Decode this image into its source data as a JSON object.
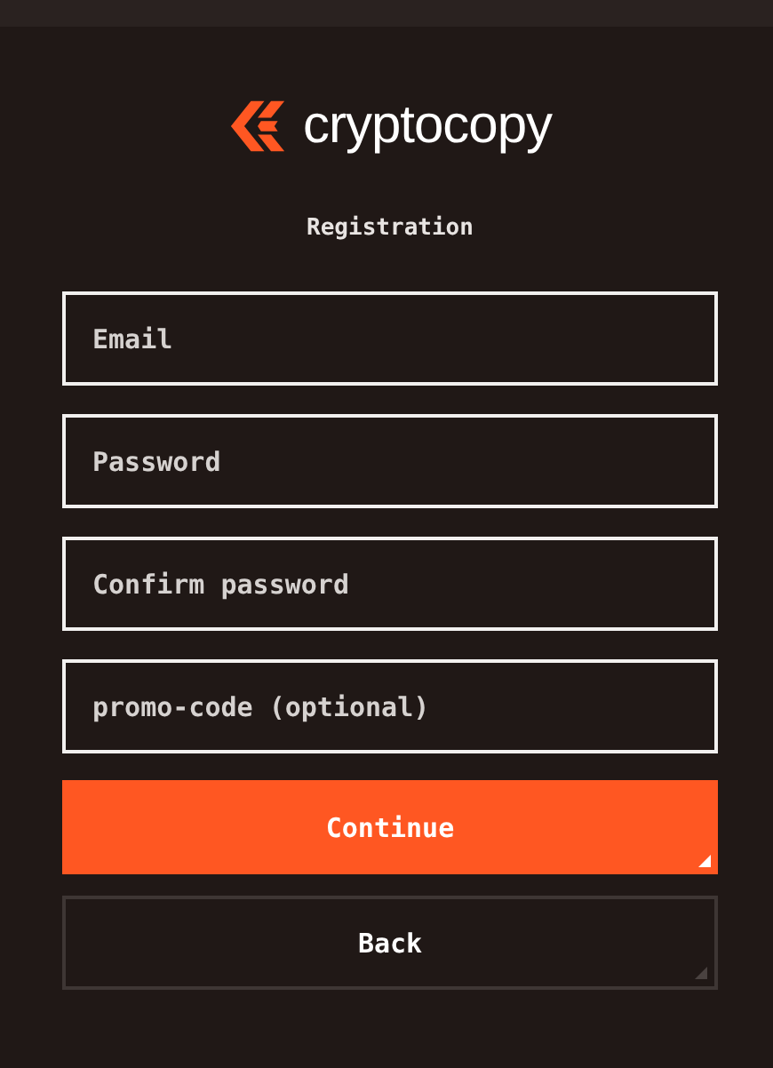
{
  "logo": {
    "text": "cryptocopy"
  },
  "heading": "Registration",
  "fields": [
    {
      "placeholder": "Email"
    },
    {
      "placeholder": "Password"
    },
    {
      "placeholder": "Confirm password"
    },
    {
      "placeholder": "promo-code (optional)"
    }
  ],
  "buttons": [
    {
      "label": "Continue",
      "kind": "primary"
    },
    {
      "label": "Back",
      "kind": "secondary"
    }
  ]
}
